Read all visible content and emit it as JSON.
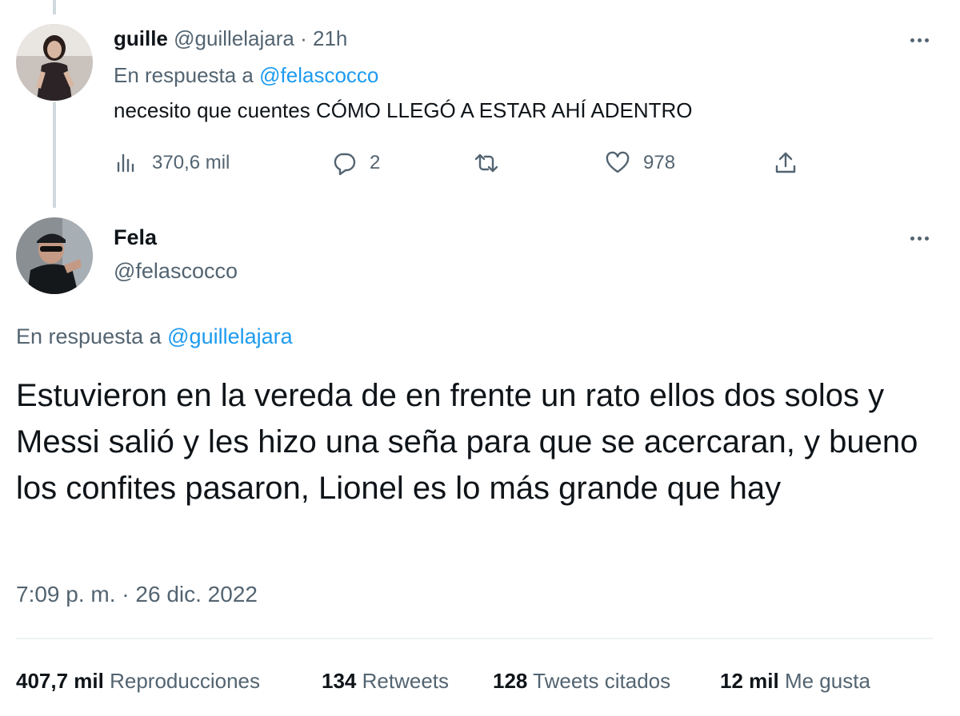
{
  "reply_tweet": {
    "name": "guille",
    "handle": "@guillelajara",
    "separator": "·",
    "time": "21h",
    "replying_prefix": "En respuesta a",
    "replying_to": "@felascocco",
    "text": "necesito que cuentes CÓMO LLEGÓ A ESTAR AHÍ ADENTRO",
    "actions": {
      "views_icon": "views-icon",
      "views": "370,6 mil",
      "reply_icon": "reply-icon",
      "replies": "2",
      "retweet_icon": "retweet-icon",
      "like_icon": "heart-icon",
      "likes": "978",
      "share_icon": "share-icon"
    }
  },
  "main_tweet": {
    "name": "Fela",
    "handle": "@felascocco",
    "replying_prefix": "En respuesta a",
    "replying_to": "@guillelajara",
    "text": "Estuvieron en la vereda de en frente un rato ellos dos solos y Messi salió y les hizo una seña para que se acercaran, y bueno los confites pasaron, Lionel es lo más grande que hay",
    "timestamp": "7:09 p. m. · 26 dic. 2022",
    "stats": {
      "views_count": "407,7 mil",
      "views_label": "Reproducciones",
      "retweets_count": "134",
      "retweets_label": "Retweets",
      "quotes_count": "128",
      "quotes_label": "Tweets citados",
      "likes_count": "12 mil",
      "likes_label": "Me gusta"
    }
  },
  "colors": {
    "accent": "#1d9bf0",
    "secondary_text": "#536471",
    "primary_text": "#0f1419",
    "divider": "#eff3f4",
    "thread_line": "#cfd9de"
  }
}
